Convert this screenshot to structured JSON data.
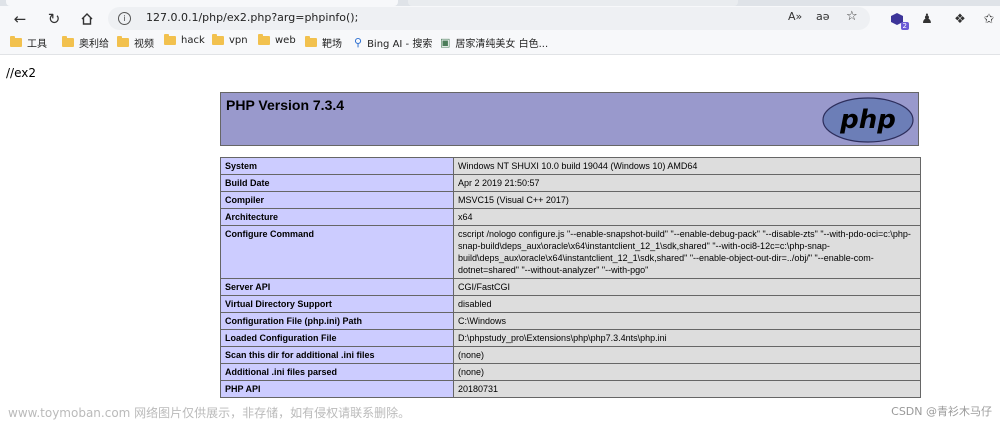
{
  "browser": {
    "nav": {
      "back_icon": "arrow-left-icon",
      "reload_icon": "reload-icon",
      "home_icon": "home-icon"
    },
    "address_url": "127.0.0.1/php/ex2.php?arg=phpinfo();",
    "read_aloud_label": "A»",
    "translate_label": "aə",
    "extension_badge": "2"
  },
  "bookmarks": [
    {
      "label": "工具",
      "icon": "folder-icon"
    },
    {
      "label": "奥利给",
      "icon": "folder-icon"
    },
    {
      "label": "视频",
      "icon": "folder-icon"
    },
    {
      "label": "hack",
      "icon": "folder-icon"
    },
    {
      "label": "vpn",
      "icon": "folder-icon"
    },
    {
      "label": "web",
      "icon": "folder-icon"
    },
    {
      "label": "靶场",
      "icon": "folder-icon"
    },
    {
      "label": "Bing AI - 搜索",
      "icon": "search-icon"
    },
    {
      "label": "居家清纯美女 白色...",
      "icon": "image-icon"
    }
  ],
  "page": {
    "label": "//ex2",
    "php_version": "PHP Version 7.3.4",
    "logo_text": "php",
    "rows": [
      {
        "key": "System",
        "value": "Windows NT SHUXI 10.0 build 19044 (Windows 10) AMD64"
      },
      {
        "key": "Build Date",
        "value": "Apr 2 2019 21:50:57"
      },
      {
        "key": "Compiler",
        "value": "MSVC15 (Visual C++ 2017)"
      },
      {
        "key": "Architecture",
        "value": "x64"
      },
      {
        "key": "Configure Command",
        "value": "cscript /nologo configure.js \"--enable-snapshot-build\" \"--enable-debug-pack\" \"--disable-zts\" \"--with-pdo-oci=c:\\php-snap-build\\deps_aux\\oracle\\x64\\instantclient_12_1\\sdk,shared\" \"--with-oci8-12c=c:\\php-snap-build\\deps_aux\\oracle\\x64\\instantclient_12_1\\sdk,shared\" \"--enable-object-out-dir=../obj/\" \"--enable-com-dotnet=shared\" \"--without-analyzer\" \"--with-pgo\""
      },
      {
        "key": "Server API",
        "value": "CGI/FastCGI"
      },
      {
        "key": "Virtual Directory Support",
        "value": "disabled"
      },
      {
        "key": "Configuration File (php.ini) Path",
        "value": "C:\\Windows"
      },
      {
        "key": "Loaded Configuration File",
        "value": "D:\\phpstudy_pro\\Extensions\\php\\php7.3.4nts\\php.ini"
      },
      {
        "key": "Scan this dir for additional .ini files",
        "value": "(none)"
      },
      {
        "key": "Additional .ini files parsed",
        "value": "(none)"
      },
      {
        "key": "PHP API",
        "value": "20180731"
      }
    ]
  },
  "overlay": {
    "watermark": "www.toymoban.com 网络图片仅供展示，非存储，如有侵权请联系删除。",
    "csdn": "CSDN @青衫木马仔"
  },
  "colors": {
    "header_bg": "#9999cc",
    "key_bg": "#ccccff",
    "value_bg": "#dddddd"
  }
}
